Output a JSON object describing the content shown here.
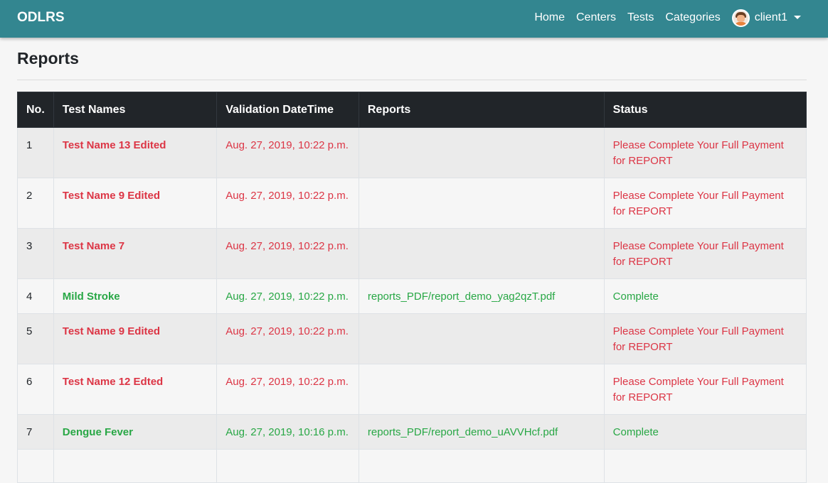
{
  "navbar": {
    "brand": "ODLRS",
    "links": [
      "Home",
      "Centers",
      "Tests",
      "Categories"
    ],
    "user": "client1"
  },
  "page": {
    "title": "Reports"
  },
  "table": {
    "headers": [
      "No.",
      "Test Names",
      "Validation DateTime",
      "Reports",
      "Status"
    ],
    "rows": [
      {
        "no": "1",
        "test": "Test Name 13 Edited",
        "datetime": "Aug. 27, 2019, 10:22 p.m.",
        "report": "",
        "status": "Please Complete Your Full Payment for REPORT"
      },
      {
        "no": "2",
        "test": "Test Name 9 Edited",
        "datetime": "Aug. 27, 2019, 10:22 p.m.",
        "report": "",
        "status": "Please Complete Your Full Payment for REPORT"
      },
      {
        "no": "3",
        "test": "Test Name 7",
        "datetime": "Aug. 27, 2019, 10:22 p.m.",
        "report": "",
        "status": "Please Complete Your Full Payment for REPORT"
      },
      {
        "no": "4",
        "test": "Mild Stroke",
        "datetime": "Aug. 27, 2019, 10:22 p.m.",
        "report": "reports_PDF/report_demo_yag2qzT.pdf",
        "status": "Complete"
      },
      {
        "no": "5",
        "test": "Test Name 9 Edited",
        "datetime": "Aug. 27, 2019, 10:22 p.m.",
        "report": "",
        "status": "Please Complete Your Full Payment for REPORT"
      },
      {
        "no": "6",
        "test": "Test Name 12 Edted",
        "datetime": "Aug. 27, 2019, 10:22 p.m.",
        "report": "",
        "status": "Please Complete Your Full Payment for REPORT"
      },
      {
        "no": "7",
        "test": "Dengue Fever",
        "datetime": "Aug. 27, 2019, 10:16 p.m.",
        "report": "reports_PDF/report_demo_uAVVHcf.pdf",
        "status": "Complete"
      }
    ]
  },
  "colors": {
    "navbar": "#338690",
    "pending": "#dc3545",
    "complete": "#28a745",
    "table_header": "#212529"
  }
}
